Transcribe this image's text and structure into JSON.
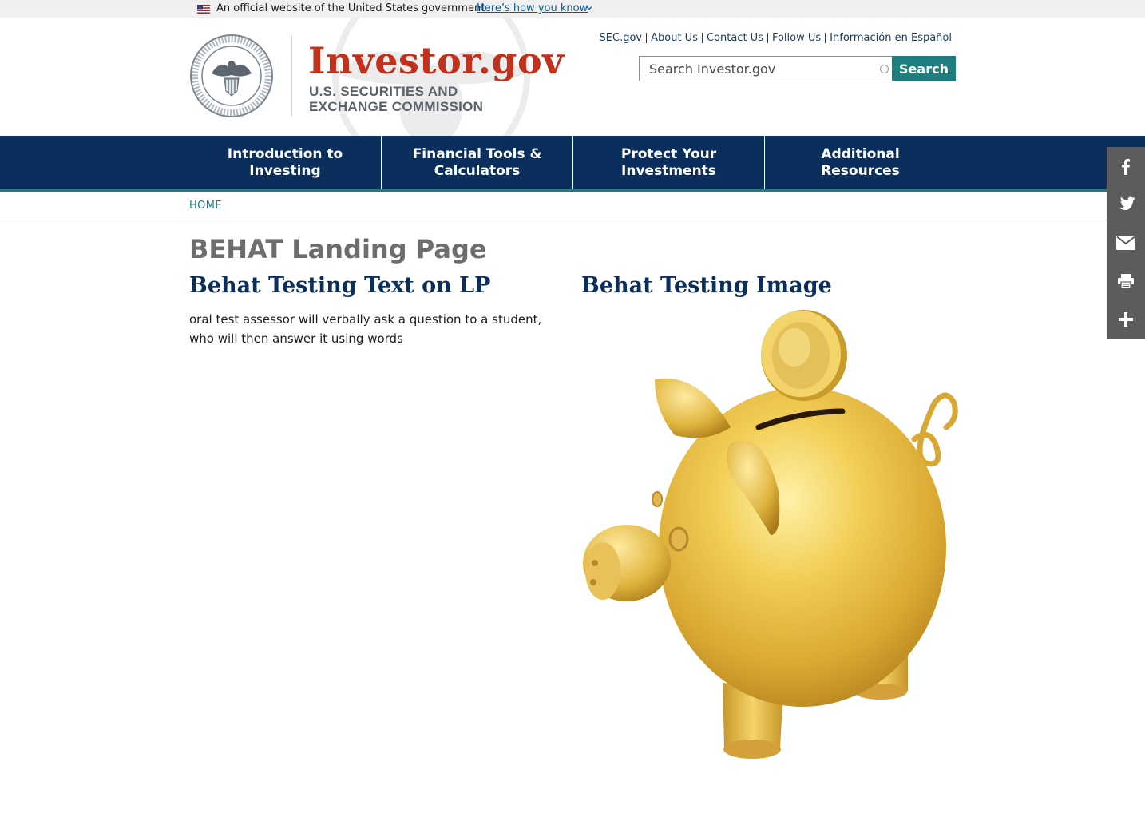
{
  "gov_banner": {
    "official_text": "An official website of the United States government",
    "how_you_know": "Here’s how you know"
  },
  "brand": {
    "title": "Investor.gov",
    "subtitle_line1": "U.S. SECURITIES AND",
    "subtitle_line2": "EXCHANGE COMMISSION"
  },
  "utility_links": [
    "SEC.gov",
    "About Us",
    "Contact Us",
    "Follow Us",
    "Información en Español"
  ],
  "search": {
    "placeholder": "Search Investor.gov",
    "button_label": "Search"
  },
  "nav": {
    "items": [
      {
        "line1": "Introduction to",
        "line2": "Investing"
      },
      {
        "line1": "Financial Tools &",
        "line2": "Calculators"
      },
      {
        "line1": "Protect Your",
        "line2": "Investments"
      },
      {
        "line1": "Additional",
        "line2": "Resources"
      }
    ]
  },
  "breadcrumb": {
    "home": "HOME"
  },
  "content": {
    "page_title": "BEHAT Landing Page",
    "left_heading": "Behat Testing Text on LP",
    "left_body": "oral test assessor will verbally ask a question to a student, who will then answer it using words",
    "right_heading": "Behat Testing Image"
  },
  "share": {
    "icons": [
      "facebook-icon",
      "twitter-icon",
      "email-icon",
      "print-icon",
      "plus-icon"
    ]
  },
  "colors": {
    "brand_red": "#c2311c",
    "nav_navy": "#0b2f5c",
    "teal": "#1f7f7f",
    "share_gray": "#5c5c5c"
  }
}
